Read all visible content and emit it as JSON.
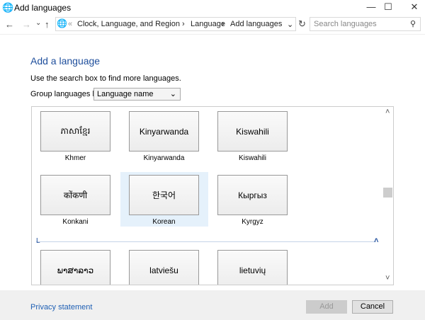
{
  "window": {
    "title": "Add languages",
    "minimize": "—",
    "maximize": "☐",
    "close": "✕"
  },
  "nav": {
    "back": "←",
    "forward": "→",
    "recent": "⌄",
    "up": "↑",
    "breadcrumb": [
      "Clock, Language, and Region",
      "Language",
      "Add languages"
    ],
    "separator": "›",
    "overflow": "«",
    "dropdown": "⌄",
    "refresh": "↻",
    "search_placeholder": "Search languages",
    "search_icon": "⚲"
  },
  "main": {
    "heading": "Add a language",
    "hint": "Use the search box to find more languages.",
    "group_label": "Group languages by:",
    "group_value": "Language name",
    "group_chevron": "⌄",
    "languages": [
      {
        "native": "ភាសាខ្មែរ",
        "name": "Khmer"
      },
      {
        "native": "Kinyarwanda",
        "name": "Kinyarwanda"
      },
      {
        "native": "Kiswahili",
        "name": "Kiswahili"
      },
      {
        "native": "कोंकणी",
        "name": "Konkani"
      },
      {
        "native": "한국어",
        "name": "Korean",
        "selected": true
      },
      {
        "native": "Кыргыз",
        "name": "Kyrgyz"
      },
      {
        "native": "ພາສາລາວ",
        "name": ""
      },
      {
        "native": "latviešu",
        "name": ""
      },
      {
        "native": "lietuvių",
        "name": ""
      }
    ],
    "section_letter": "L",
    "collapse_icon": "˄",
    "scroll_up": "˄",
    "scroll_down": "˅"
  },
  "footer": {
    "privacy": "Privacy statement",
    "add": "Add",
    "cancel": "Cancel"
  }
}
